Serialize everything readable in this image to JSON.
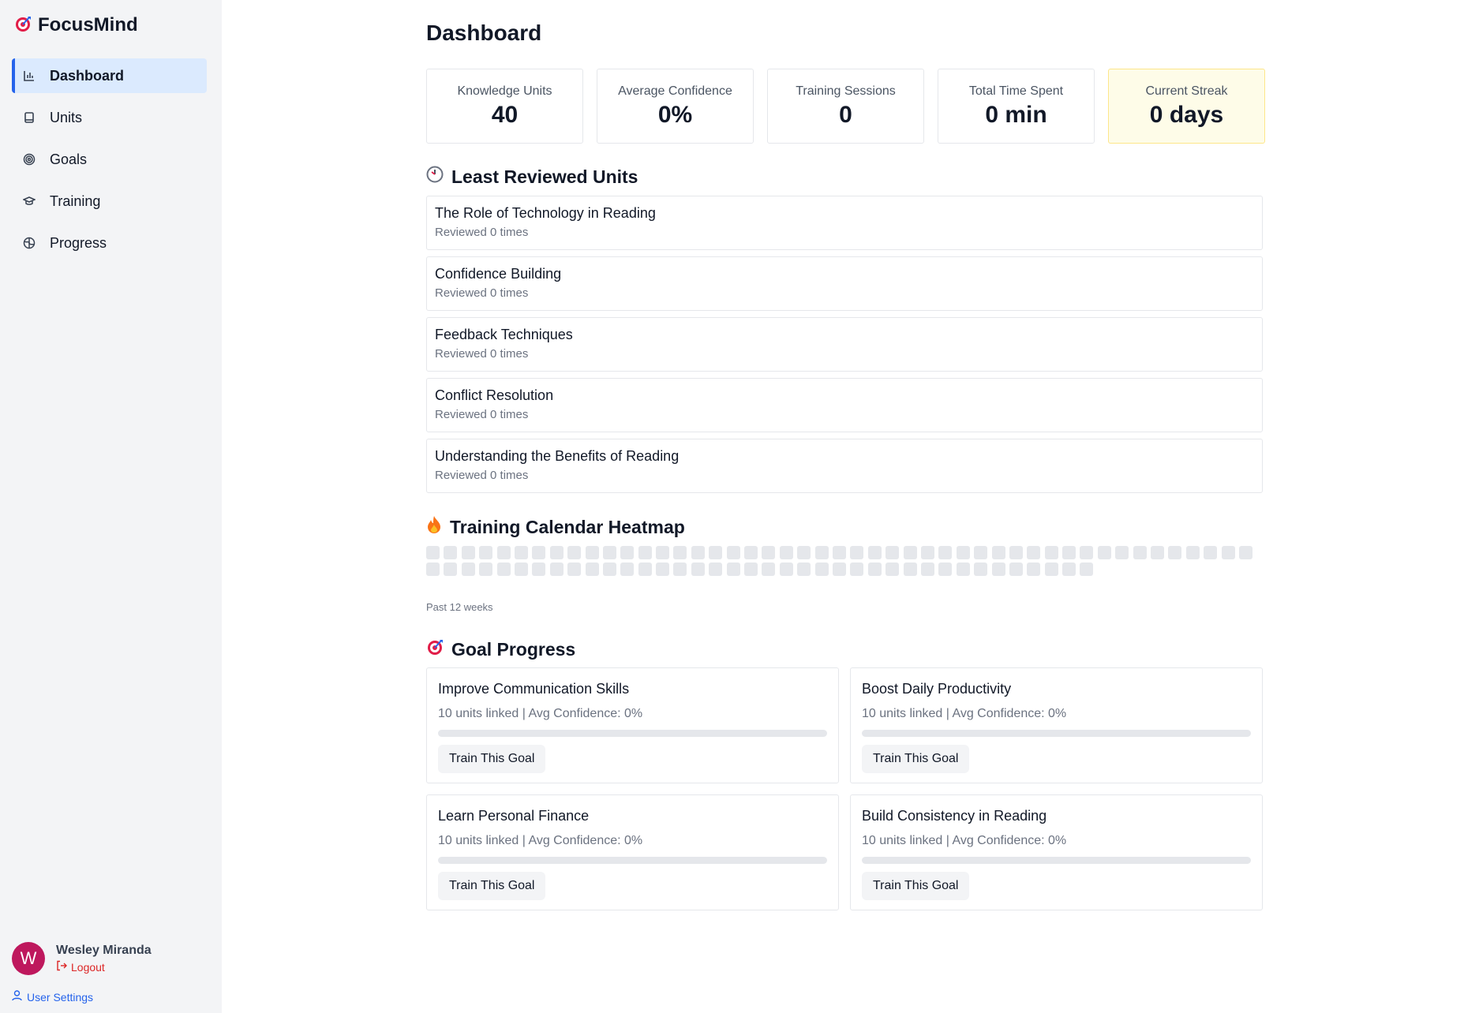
{
  "app": {
    "name": "FocusMind"
  },
  "sidebar": {
    "items": [
      {
        "label": "Dashboard",
        "icon": "bar-chart-icon",
        "active": true
      },
      {
        "label": "Units",
        "icon": "book-icon"
      },
      {
        "label": "Goals",
        "icon": "target-icon"
      },
      {
        "label": "Training",
        "icon": "graduation-cap-icon"
      },
      {
        "label": "Progress",
        "icon": "globe-icon"
      }
    ],
    "user": {
      "initial": "W",
      "name": "Wesley Miranda",
      "logout": "Logout",
      "settings": "User Settings"
    }
  },
  "main": {
    "title": "Dashboard",
    "stats": [
      {
        "label": "Knowledge Units",
        "value": "40"
      },
      {
        "label": "Average Confidence",
        "value": "0%"
      },
      {
        "label": "Training Sessions",
        "value": "0"
      },
      {
        "label": "Total Time Spent",
        "value": "0 min"
      },
      {
        "label": "Current Streak",
        "value": "0 days"
      }
    ],
    "least_reviewed": {
      "title": "Least Reviewed Units",
      "icon": "clock-icon",
      "items": [
        {
          "name": "The Role of Technology in Reading",
          "meta": "Reviewed 0 times"
        },
        {
          "name": "Confidence Building",
          "meta": "Reviewed 0 times"
        },
        {
          "name": "Feedback Techniques",
          "meta": "Reviewed 0 times"
        },
        {
          "name": "Conflict Resolution",
          "meta": "Reviewed 0 times"
        },
        {
          "name": "Understanding the Benefits of Reading",
          "meta": "Reviewed 0 times"
        }
      ]
    },
    "heatmap": {
      "title": "Training Calendar Heatmap",
      "icon": "flame-icon",
      "caption": "Past 12 weeks",
      "cell_color": "#e5e7eb",
      "values": [
        0,
        0,
        0,
        0,
        0,
        0,
        0,
        0,
        0,
        0,
        0,
        0,
        0,
        0,
        0,
        0,
        0,
        0,
        0,
        0,
        0,
        0,
        0,
        0,
        0,
        0,
        0,
        0,
        0,
        0,
        0,
        0,
        0,
        0,
        0,
        0,
        0,
        0,
        0,
        0,
        0,
        0,
        0,
        0,
        0,
        0,
        0,
        0,
        0,
        0,
        0,
        0,
        0,
        0,
        0,
        0,
        0,
        0,
        0,
        0,
        0,
        0,
        0,
        0,
        0,
        0,
        0,
        0,
        0,
        0,
        0,
        0,
        0,
        0,
        0,
        0,
        0,
        0,
        0,
        0,
        0,
        0,
        0,
        0,
        0
      ]
    },
    "goals": {
      "title": "Goal Progress",
      "icon": "target-icon",
      "button_label": "Train This Goal",
      "items": [
        {
          "name": "Improve Communication Skills",
          "meta": "10 units linked | Avg Confidence: 0%",
          "progress": 0
        },
        {
          "name": "Boost Daily Productivity",
          "meta": "10 units linked | Avg Confidence: 0%",
          "progress": 0
        },
        {
          "name": "Learn Personal Finance",
          "meta": "10 units linked | Avg Confidence: 0%",
          "progress": 0
        },
        {
          "name": "Build Consistency in Reading",
          "meta": "10 units linked | Avg Confidence: 0%",
          "progress": 0
        }
      ]
    }
  },
  "colors": {
    "accent": "#2563eb",
    "active_bg": "#dbeafe",
    "streak_bg": "#fefce8",
    "avatar": "#be185d",
    "logout": "#dc2626"
  }
}
